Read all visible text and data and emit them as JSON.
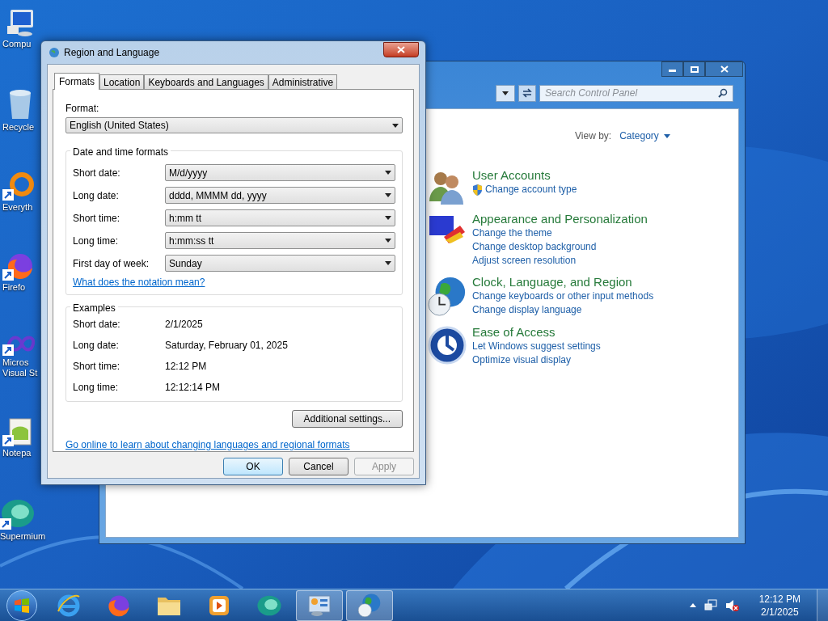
{
  "desktop_icons": [
    {
      "kind": "computer",
      "label": "Compu",
      "shortcut": false
    },
    {
      "kind": "recycle",
      "label": "Recycle",
      "shortcut": false
    },
    {
      "kind": "ring",
      "label": "Everyth",
      "shortcut": true
    },
    {
      "kind": "firefox",
      "label": "Firefo",
      "shortcut": true
    },
    {
      "kind": "infinity",
      "label": "Micros Visual St",
      "shortcut": true
    },
    {
      "kind": "notepad",
      "label": "Notepa",
      "shortcut": true
    },
    {
      "kind": "supermium",
      "label": "Supermium",
      "shortcut": true
    }
  ],
  "control_panel": {
    "search": {
      "placeholder": "Search Control Panel"
    },
    "view_by_label": "View by:",
    "view_by_value": "Category",
    "categories": [
      {
        "kind": "users",
        "title": "User Accounts",
        "links": [
          {
            "text": "Change account type",
            "shield": true
          }
        ]
      },
      {
        "kind": "appearance",
        "title": "Appearance and Personalization",
        "links": [
          {
            "text": "Change the theme",
            "shield": false
          },
          {
            "text": "Change desktop background",
            "shield": false
          },
          {
            "text": "Adjust screen resolution",
            "shield": false
          }
        ]
      },
      {
        "kind": "clock",
        "title": "Clock, Language, and Region",
        "links": [
          {
            "text": "Change keyboards or other input methods",
            "shield": false
          },
          {
            "text": "Change display language",
            "shield": false
          }
        ]
      },
      {
        "kind": "access",
        "title": "Ease of Access",
        "links": [
          {
            "text": "Let Windows suggest settings",
            "shield": false
          },
          {
            "text": "Optimize visual display",
            "shield": false
          }
        ]
      }
    ]
  },
  "dialog": {
    "title": "Region and Language",
    "tabs": [
      {
        "label": "Formats",
        "selected": true
      },
      {
        "label": "Location",
        "selected": false
      },
      {
        "label": "Keyboards and Languages",
        "selected": false
      },
      {
        "label": "Administrative",
        "selected": false
      }
    ],
    "format_label": "Format:",
    "format_value": "English (United States)",
    "date_time_group": "Date and time formats",
    "fields": [
      {
        "label": "Short date:",
        "value": "M/d/yyyy"
      },
      {
        "label": "Long date:",
        "value": "dddd, MMMM dd, yyyy"
      },
      {
        "label": "Short time:",
        "value": "h:mm tt"
      },
      {
        "label": "Long time:",
        "value": "h:mm:ss tt"
      },
      {
        "label": "First day of week:",
        "value": "Sunday"
      }
    ],
    "notation_link": "What does the notation mean?",
    "examples_group": "Examples",
    "examples": [
      {
        "label": "Short date:",
        "value": "2/1/2025"
      },
      {
        "label": "Long date:",
        "value": "Saturday, February 01, 2025"
      },
      {
        "label": "Short time:",
        "value": "12:12 PM"
      },
      {
        "label": "Long time:",
        "value": "12:12:14 PM"
      }
    ],
    "additional_button": "Additional settings...",
    "online_link": "Go online to learn about changing languages and regional formats",
    "buttons": [
      {
        "label": "OK",
        "default": true,
        "disabled": false
      },
      {
        "label": "Cancel",
        "default": false,
        "disabled": false
      },
      {
        "label": "Apply",
        "default": false,
        "disabled": true
      }
    ]
  },
  "taskbar": {
    "apps": [
      {
        "kind": "ie",
        "active": false
      },
      {
        "kind": "firefox",
        "active": false
      },
      {
        "kind": "folder",
        "active": false
      },
      {
        "kind": "media",
        "active": false
      },
      {
        "kind": "supermium",
        "active": false
      },
      {
        "kind": "control",
        "active": true
      },
      {
        "kind": "globe",
        "active": true
      }
    ],
    "time": "12:12 PM",
    "date": "2/1/2025"
  }
}
